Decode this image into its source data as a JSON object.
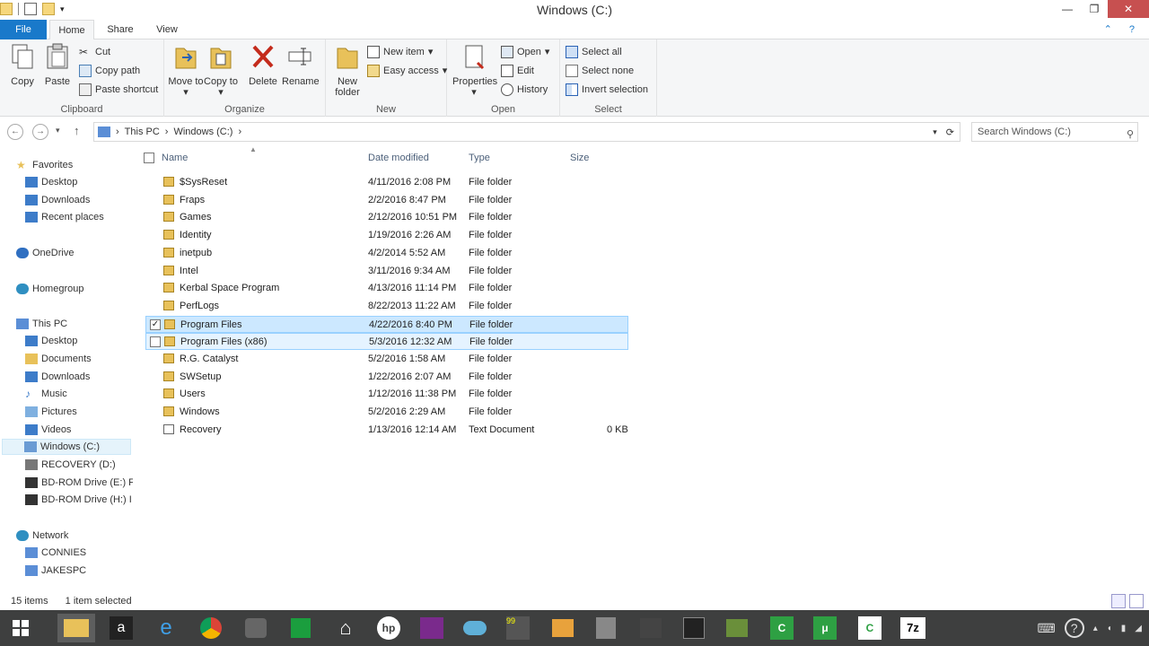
{
  "window": {
    "title": "Windows (C:)"
  },
  "tabs": [
    "File",
    "Home",
    "Share",
    "View"
  ],
  "ribbon": {
    "clipboard": {
      "label": "Clipboard",
      "copy": "Copy",
      "paste": "Paste",
      "cut": "Cut",
      "copy_path": "Copy path",
      "paste_shortcut": "Paste shortcut"
    },
    "organize": {
      "label": "Organize",
      "move_to": "Move to",
      "copy_to": "Copy to",
      "delete": "Delete",
      "rename": "Rename"
    },
    "new": {
      "label": "New",
      "new_folder": "New folder",
      "new_item": "New item",
      "easy_access": "Easy access"
    },
    "open": {
      "label": "Open",
      "properties": "Properties",
      "open": "Open",
      "edit": "Edit",
      "history": "History"
    },
    "select": {
      "label": "Select",
      "select_all": "Select all",
      "select_none": "Select none",
      "invert": "Invert selection"
    }
  },
  "address": {
    "crumb1": "This PC",
    "crumb2": "Windows (C:)"
  },
  "search": {
    "placeholder": "Search Windows (C:)"
  },
  "sidebar": {
    "favorites": "Favorites",
    "desktop": "Desktop",
    "downloads": "Downloads",
    "recent": "Recent places",
    "onedrive": "OneDrive",
    "homegroup": "Homegroup",
    "thispc": "This PC",
    "pc_desktop": "Desktop",
    "pc_documents": "Documents",
    "pc_downloads": "Downloads",
    "pc_music": "Music",
    "pc_pictures": "Pictures",
    "pc_videos": "Videos",
    "pc_windows": "Windows (C:)",
    "pc_recovery": "RECOVERY (D:)",
    "pc_bde": "BD-ROM Drive (E:) F",
    "pc_bdh": "BD-ROM Drive (H:) I",
    "network": "Network",
    "connies": "CONNIES",
    "jakespc": "JAKESPC"
  },
  "columns": {
    "name": "Name",
    "date": "Date modified",
    "type": "Type",
    "size": "Size"
  },
  "files": [
    {
      "name": "$SysReset",
      "date": "4/11/2016 2:08 PM",
      "type": "File folder",
      "size": ""
    },
    {
      "name": "Fraps",
      "date": "2/2/2016 8:47 PM",
      "type": "File folder",
      "size": ""
    },
    {
      "name": "Games",
      "date": "2/12/2016 10:51 PM",
      "type": "File folder",
      "size": ""
    },
    {
      "name": "Identity",
      "date": "1/19/2016 2:26 AM",
      "type": "File folder",
      "size": ""
    },
    {
      "name": "inetpub",
      "date": "4/2/2014 5:52 AM",
      "type": "File folder",
      "size": ""
    },
    {
      "name": "Intel",
      "date": "3/11/2016 9:34 AM",
      "type": "File folder",
      "size": ""
    },
    {
      "name": "Kerbal Space Program",
      "date": "4/13/2016 11:14 PM",
      "type": "File folder",
      "size": ""
    },
    {
      "name": "PerfLogs",
      "date": "8/22/2013 11:22 AM",
      "type": "File folder",
      "size": ""
    },
    {
      "name": "Program Files",
      "date": "4/22/2016 8:40 PM",
      "type": "File folder",
      "size": ""
    },
    {
      "name": "Program Files (x86)",
      "date": "5/3/2016 12:32 AM",
      "type": "File folder",
      "size": ""
    },
    {
      "name": "R.G. Catalyst",
      "date": "5/2/2016 1:58 AM",
      "type": "File folder",
      "size": ""
    },
    {
      "name": "SWSetup",
      "date": "1/22/2016 2:07 AM",
      "type": "File folder",
      "size": ""
    },
    {
      "name": "Users",
      "date": "1/12/2016 11:38 PM",
      "type": "File folder",
      "size": ""
    },
    {
      "name": "Windows",
      "date": "5/2/2016 2:29 AM",
      "type": "File folder",
      "size": ""
    },
    {
      "name": "Recovery",
      "date": "1/13/2016 12:14 AM",
      "type": "Text Document",
      "size": "0 KB"
    }
  ],
  "status": {
    "count": "15 items",
    "selected": "1 item selected"
  },
  "colors": {
    "accent": "#1979ca",
    "selection": "#cce8ff",
    "folder": "#e8c15a"
  }
}
